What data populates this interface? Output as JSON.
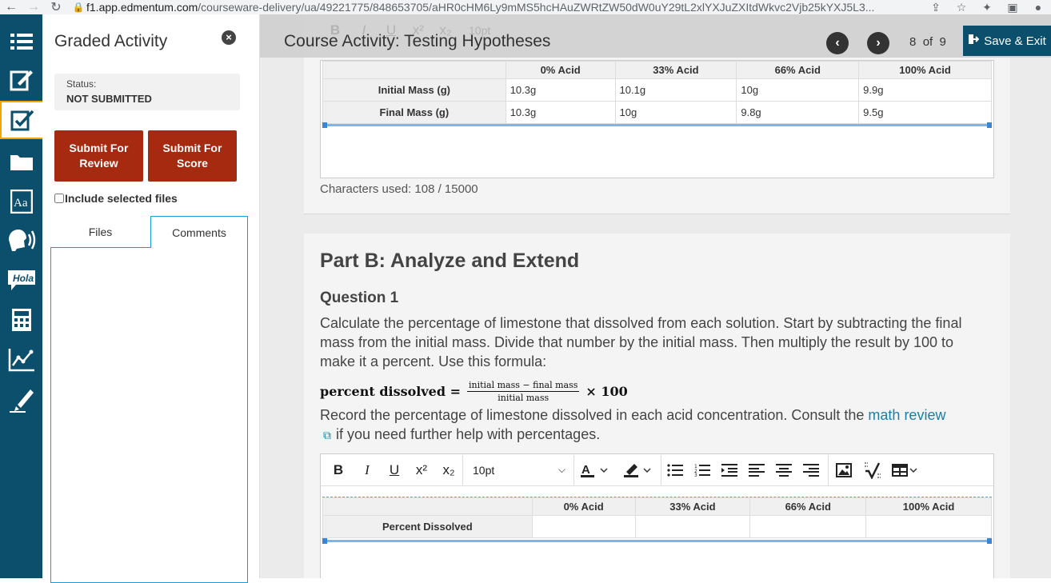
{
  "browser": {
    "url_host": "f1.app.edmentum.com",
    "url_path": "/courseware-delivery/ua/49221775/848653705/aHR0cHM6Ly9mMS5hcHAuZWRtZW50dW0uY29tL2xlYXJuZXItdWkvc2Vjb25kYXJ5L3..."
  },
  "panel": {
    "title": "Graded Activity",
    "status_label": "Status:",
    "status_value": "NOT SUBMITTED",
    "submit_review": "Submit For Review",
    "submit_score": "Submit For Score",
    "include_label": "Include selected files",
    "tab_files": "Files",
    "tab_comments": "Comments"
  },
  "header": {
    "title": "Course Activity: Testing Hypotheses",
    "page_current": "8",
    "page_of": "of",
    "page_total": "9",
    "save_exit": "Save & Exit"
  },
  "table1": {
    "columns": [
      "",
      "0% Acid",
      "33% Acid",
      "66% Acid",
      "100% Acid"
    ],
    "rows": [
      {
        "label": "Initial Mass (g)",
        "values": [
          "10.3g",
          "10.1g",
          "10g",
          "9.9g"
        ]
      },
      {
        "label": "Final Mass (g)",
        "values": [
          "10.3g",
          "10g",
          "9.8g",
          "9.5g"
        ]
      }
    ]
  },
  "chars_used": "Characters used: 108 / 15000",
  "partB": {
    "title": "Part B: Analyze and Extend",
    "question": "Question 1",
    "instructions": "Calculate the percentage of limestone that dissolved from each solution. Start by subtracting the final mass from the initial mass. Divide that number by the initial mass. Then multiply the result by 100 to make it a percent. Use this formula:",
    "formula_lhs": "percent dissolved =",
    "formula_num": "initial mass − final mass",
    "formula_den": "initial mass",
    "formula_rhs": "× 100",
    "record_text": "Record the percentage of limestone dissolved in each acid concentration. Consult the",
    "link_text": "math review",
    "record_tail": "if you need further help with percentages."
  },
  "toolbar": {
    "bold": "B",
    "italic": "I",
    "underline": "U",
    "superscript": "x²",
    "subscript": "x₂",
    "font_size": "10pt"
  },
  "table2": {
    "columns": [
      "",
      "0% Acid",
      "33% Acid",
      "66% Acid",
      "100% Acid"
    ],
    "row_label": "Percent Dissolved"
  }
}
